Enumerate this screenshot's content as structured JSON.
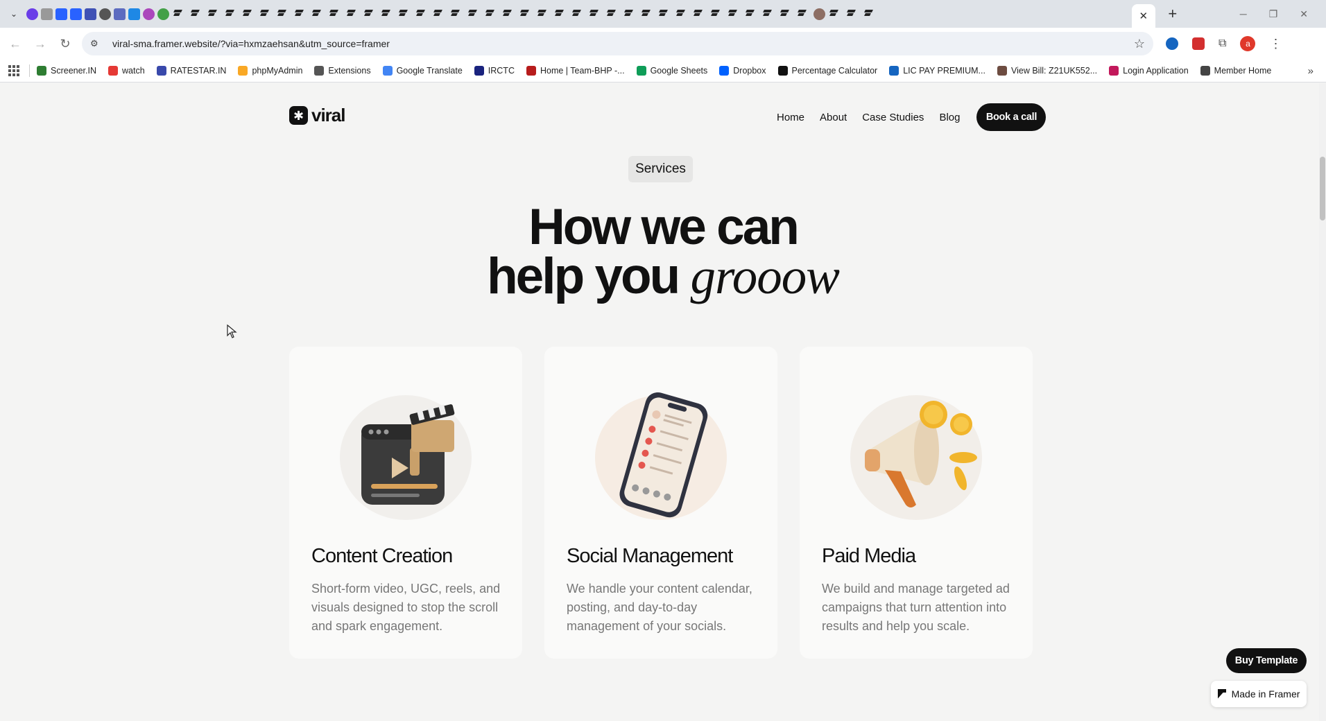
{
  "browser": {
    "active_tab_close": "✕",
    "new_tab": "+",
    "window_controls": [
      "─",
      "❐",
      "✕"
    ],
    "url": "viral-sma.framer.website/?via=hxmzaehsan&utm_source=framer",
    "profile_initial": "a",
    "bookmarks": [
      {
        "label": "Screener.IN",
        "color": "#2e7d32"
      },
      {
        "label": "watch",
        "color": "#e53935"
      },
      {
        "label": "RATESTAR.IN",
        "color": "#3949ab"
      },
      {
        "label": "phpMyAdmin",
        "color": "#f9a825"
      },
      {
        "label": "Extensions",
        "color": "#555555"
      },
      {
        "label": "Google Translate",
        "color": "#4285f4"
      },
      {
        "label": "IRCTC",
        "color": "#1a237e"
      },
      {
        "label": "Home | Team-BHP -...",
        "color": "#b71c1c"
      },
      {
        "label": "Google Sheets",
        "color": "#0f9d58"
      },
      {
        "label": "Dropbox",
        "color": "#0061fe"
      },
      {
        "label": "Percentage Calculator",
        "color": "#111111"
      },
      {
        "label": "LIC PAY PREMIUM...",
        "color": "#1565c0"
      },
      {
        "label": "View Bill: Z21UK552...",
        "color": "#6d4c41"
      },
      {
        "label": "Login Application",
        "color": "#c2185b"
      },
      {
        "label": "Member Home",
        "color": "#444444"
      }
    ],
    "bookmarks_more": "»"
  },
  "site": {
    "logo_text": "viral",
    "logo_mark": "✱",
    "nav": [
      "Home",
      "About",
      "Case Studies",
      "Blog"
    ],
    "cta": "Book a call",
    "section_pill": "Services",
    "headline_line1": "How we can",
    "headline_line2": "help you ",
    "headline_italic": "grooow",
    "cards": [
      {
        "title": "Content Creation",
        "desc": "Short-form video, UGC, reels, and visuals designed to stop the scroll and spark engagement.",
        "icon": "clapperboard-video-icon"
      },
      {
        "title": "Social Management",
        "desc": "We handle your content calendar, posting, and day-to-day management of your socials.",
        "icon": "smartphone-social-feed-icon"
      },
      {
        "title": "Paid Media",
        "desc": "We build and manage targeted ad campaigns that turn attention into results and help you scale.",
        "icon": "megaphone-coins-icon"
      }
    ],
    "buy_template": "Buy Template",
    "made_in_framer": "Made in Framer"
  }
}
